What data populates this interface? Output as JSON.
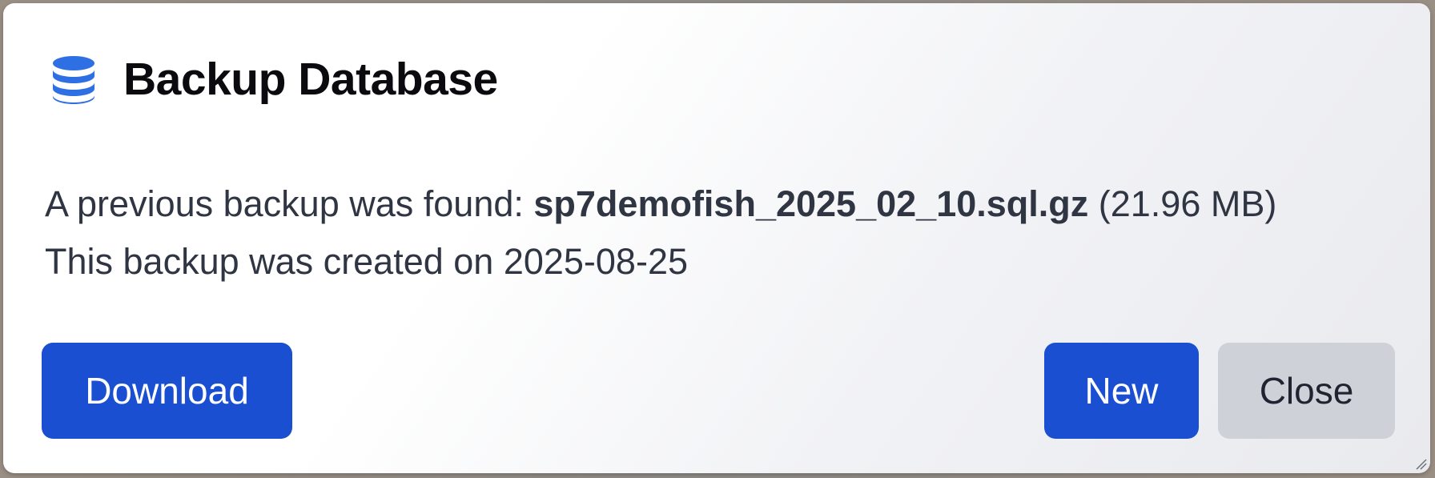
{
  "dialog": {
    "title": "Backup Database",
    "icon": "database-icon",
    "accent_color": "#2f6fe4",
    "message": {
      "found_prefix": "A previous backup was found: ",
      "filename": "sp7demofish_2025_02_10.sql.gz",
      "size": " (21.96 MB)",
      "created_prefix": "This backup was created on ",
      "created_date": "2025-08-25"
    },
    "buttons": {
      "download_label": "Download",
      "new_label": "New",
      "close_label": "Close"
    }
  }
}
